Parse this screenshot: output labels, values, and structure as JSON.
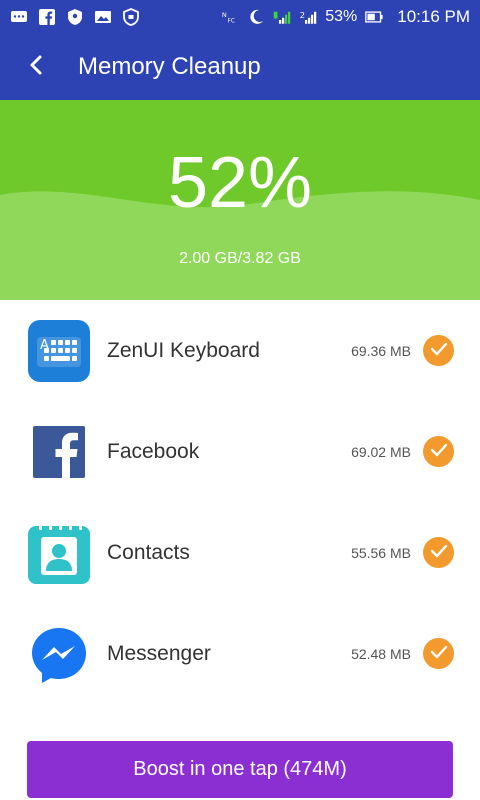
{
  "status_bar": {
    "battery_percent": "53%",
    "time": "10:16 PM",
    "left_icons": [
      "message-icon",
      "facebook-icon",
      "shield-icon",
      "image-icon",
      "secure-icon"
    ],
    "right_icons": [
      "nfc-icon",
      "moon-icon",
      "signal-1-icon",
      "signal-2-icon",
      "battery-icon"
    ]
  },
  "app_bar": {
    "title": "Memory Cleanup",
    "back_icon": "chevron-left-icon"
  },
  "memory": {
    "percent": "52%",
    "usage": "2.00 GB/3.82 GB"
  },
  "apps": [
    {
      "name": "ZenUI Keyboard",
      "size": "69.36 MB",
      "icon": "keyboard-icon",
      "color": "#1e7fd8",
      "checked": true
    },
    {
      "name": "Facebook",
      "size": "69.02 MB",
      "icon": "facebook-icon",
      "color": "#3b5998",
      "checked": true
    },
    {
      "name": "Contacts",
      "size": "55.56 MB",
      "icon": "contacts-icon",
      "color": "#30c2c9",
      "checked": true
    },
    {
      "name": "Messenger",
      "size": "52.48 MB",
      "icon": "messenger-icon",
      "color": "#1976f2",
      "checked": true
    }
  ],
  "boost": {
    "label": "Boost in one tap (474M)"
  },
  "colors": {
    "header_blue": "#2d42b3",
    "memory_green": "#70c92a",
    "check_orange": "#f29a2e",
    "boost_purple": "#8b2fd3"
  }
}
